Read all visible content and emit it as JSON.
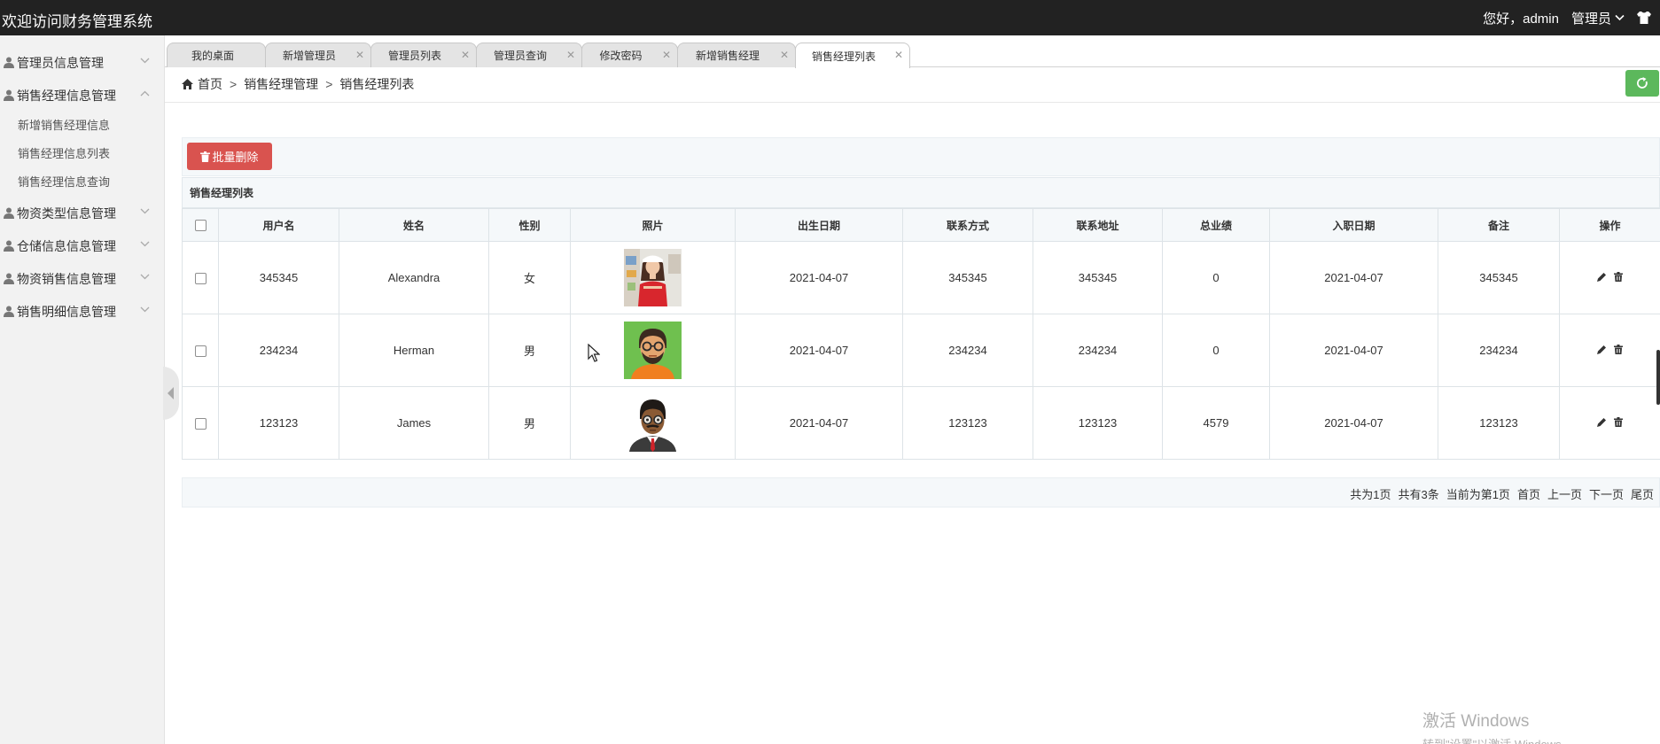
{
  "app": {
    "title": "欢迎访问财务管理系统",
    "greeting": "您好，admin",
    "admin_menu_label": "管理员"
  },
  "sidebar": {
    "items": [
      {
        "label": "管理员信息管理",
        "expanded": false
      },
      {
        "label": "销售经理信息管理",
        "expanded": true,
        "children": [
          "新增销售经理信息",
          "销售经理信息列表",
          "销售经理信息查询"
        ]
      },
      {
        "label": "物资类型信息管理",
        "expanded": false
      },
      {
        "label": "仓储信息信息管理",
        "expanded": false
      },
      {
        "label": "物资销售信息管理",
        "expanded": false
      },
      {
        "label": "销售明细信息管理",
        "expanded": false
      }
    ]
  },
  "tabs": [
    {
      "label": "我的桌面",
      "closable": false,
      "active": false
    },
    {
      "label": "新增管理员",
      "closable": true,
      "active": false
    },
    {
      "label": "管理员列表",
      "closable": true,
      "active": false
    },
    {
      "label": "管理员查询",
      "closable": true,
      "active": false
    },
    {
      "label": "修改密码",
      "closable": true,
      "active": false
    },
    {
      "label": "新增销售经理",
      "closable": true,
      "active": false
    },
    {
      "label": "销售经理列表",
      "closable": true,
      "active": true
    }
  ],
  "breadcrumb": [
    "首页",
    "销售经理管理",
    "销售经理列表"
  ],
  "actions": {
    "batch_delete_label": "批量删除"
  },
  "table": {
    "panel_title": "销售经理列表",
    "columns": [
      "用户名",
      "姓名",
      "性别",
      "照片",
      "出生日期",
      "联系方式",
      "联系地址",
      "总业绩",
      "入职日期",
      "备注",
      "操作"
    ],
    "rows": [
      {
        "username": "345345",
        "name": "Alexandra",
        "gender": "女",
        "photo": "woman-photo",
        "birth": "2021-04-07",
        "contact": "345345",
        "address": "345345",
        "performance": "0",
        "hire_date": "2021-04-07",
        "note": "345345"
      },
      {
        "username": "234234",
        "name": "Herman",
        "gender": "男",
        "photo": "bearded-man-avatar",
        "birth": "2021-04-07",
        "contact": "234234",
        "address": "234234",
        "performance": "0",
        "hire_date": "2021-04-07",
        "note": "234234"
      },
      {
        "username": "123123",
        "name": "James",
        "gender": "男",
        "photo": "businessman-avatar",
        "birth": "2021-04-07",
        "contact": "123123",
        "address": "123123",
        "performance": "4579",
        "hire_date": "2021-04-07",
        "note": "123123"
      }
    ]
  },
  "pagination": {
    "total_pages": "共为1页",
    "total_records": "共有3条",
    "current": "当前为第1页",
    "first": "首页",
    "prev": "上一页",
    "next": "下一页",
    "last": "尾页"
  },
  "watermark": {
    "line1": "激活 Windows",
    "line2": "转到\"设置\"以激活 Windows。"
  },
  "colors": {
    "topbar": "#222222",
    "danger": "#d9534f",
    "success": "#5cb85c",
    "sidebar": "#f2f2f2"
  }
}
